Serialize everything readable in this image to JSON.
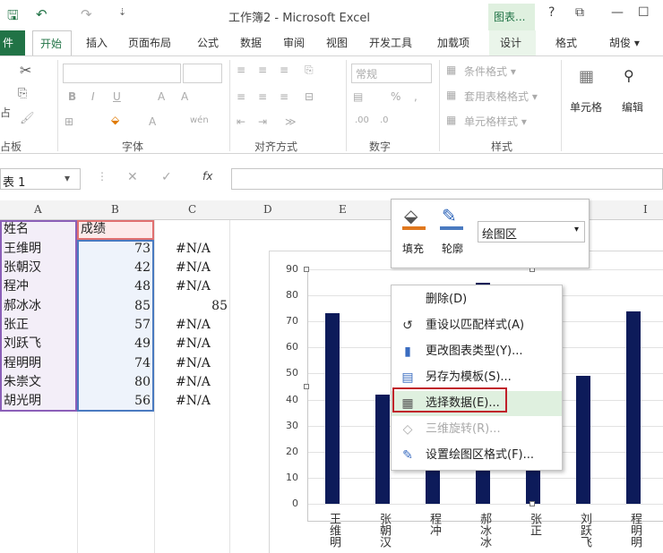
{
  "titlebar": {
    "title": "工作簿2 - Microsoft Excel",
    "context_tab": "图表...",
    "help": "?",
    "restore": "⧉",
    "min": "—",
    "max": "☐"
  },
  "tabs": {
    "file": "件",
    "items": [
      "开始",
      "插入",
      "页面布局",
      "公式",
      "数据",
      "审阅",
      "视图",
      "开发工具",
      "加载项",
      "设计",
      "格式",
      "胡俊 ▾"
    ]
  },
  "ribbon": {
    "groups": [
      "粘贴板",
      "字体",
      "对齐方式",
      "数字",
      "样式"
    ],
    "number_format": "常规",
    "styles": [
      "条件格式 ▾",
      "套用表格格式 ▾",
      "单元格样式 ▾"
    ],
    "cells_label": "单元格",
    "edit_label": "编辑",
    "paste_label": "占",
    "clipboard_label": "占板"
  },
  "formulabar": {
    "name_box": "表 1",
    "fx": "fx"
  },
  "columns": [
    "A",
    "B",
    "C",
    "D",
    "E",
    "I"
  ],
  "sheet": {
    "header": [
      "姓名",
      "成绩"
    ],
    "rows": [
      {
        "name": "王维明",
        "score": "73",
        "c": "#N/A"
      },
      {
        "name": "张朝汉",
        "score": "42",
        "c": "#N/A"
      },
      {
        "name": "程冲",
        "score": "48",
        "c": "#N/A"
      },
      {
        "name": "郝冰冰",
        "score": "85",
        "c": "85"
      },
      {
        "name": "张正",
        "score": "57",
        "c": "#N/A"
      },
      {
        "name": "刘跃飞",
        "score": "49",
        "c": "#N/A"
      },
      {
        "name": "程明明",
        "score": "74",
        "c": "#N/A"
      },
      {
        "name": "朱崇文",
        "score": "80",
        "c": "#N/A"
      },
      {
        "name": "胡光明",
        "score": "56",
        "c": "#N/A"
      }
    ]
  },
  "chart_data": {
    "type": "bar",
    "categories": [
      "王维明",
      "张朝汉",
      "程冲",
      "郝冰冰",
      "张正",
      "刘跃飞",
      "程明明"
    ],
    "values": [
      73,
      42,
      48,
      85,
      57,
      49,
      74
    ],
    "ylim": [
      0,
      90
    ],
    "yticks": [
      "90",
      "80",
      "70",
      "60",
      "50",
      "40",
      "30",
      "20",
      "10",
      "0"
    ],
    "bar_color": "#0d1b5a"
  },
  "mini_toolbar": {
    "fill": "填充",
    "outline": "轮廓",
    "area_select": "绘图区"
  },
  "context_menu": {
    "items": [
      {
        "label": "删除(D)",
        "icon": "",
        "disabled": false
      },
      {
        "label": "重设以匹配样式(A)",
        "icon": "↺",
        "disabled": false
      },
      {
        "label": "更改图表类型(Y)...",
        "icon": "▮",
        "disabled": false
      },
      {
        "label": "另存为模板(S)...",
        "icon": "▤",
        "disabled": false
      },
      {
        "label": "选择数据(E)...",
        "icon": "▦",
        "disabled": false
      },
      {
        "label": "三维旋转(R)...",
        "icon": "◇",
        "disabled": true
      },
      {
        "label": "设置绘图区格式(F)...",
        "icon": "✎",
        "disabled": false
      }
    ]
  }
}
